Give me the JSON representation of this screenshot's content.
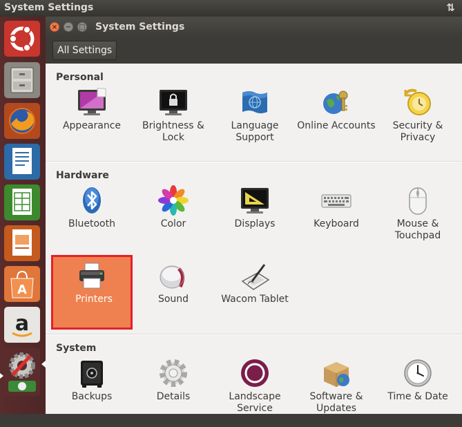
{
  "top_panel": {
    "title": "System Settings",
    "arrows_icon": "network-updown-icon"
  },
  "launcher": {
    "items": [
      {
        "name": "ubuntu-dash",
        "icon": "ubuntu-logo-icon"
      },
      {
        "name": "files",
        "icon": "file-cabinet-icon"
      },
      {
        "name": "firefox",
        "icon": "firefox-icon"
      },
      {
        "name": "writer",
        "icon": "libreoffice-writer-icon"
      },
      {
        "name": "calc",
        "icon": "libreoffice-calc-icon"
      },
      {
        "name": "impress",
        "icon": "libreoffice-impress-icon"
      },
      {
        "name": "software-center",
        "icon": "shopping-bag-icon"
      },
      {
        "name": "amazon",
        "icon": "amazon-icon"
      },
      {
        "name": "system-settings",
        "icon": "settings-gear-icon"
      }
    ]
  },
  "window": {
    "title": "System Settings",
    "close_glyph": "×",
    "min_glyph": "−",
    "max_glyph": "□",
    "toolbar": {
      "all_settings_label": "All Settings"
    }
  },
  "sections": {
    "personal": {
      "title": "Personal",
      "items": [
        {
          "label": "Appearance",
          "icon": "appearance-monitor-icon"
        },
        {
          "label": "Brightness & Lock",
          "icon": "brightness-lock-icon"
        },
        {
          "label": "Language Support",
          "icon": "language-flag-icon"
        },
        {
          "label": "Online Accounts",
          "icon": "online-accounts-globe-icon"
        },
        {
          "label": "Security & Privacy",
          "icon": "security-clock-icon"
        }
      ]
    },
    "hardware": {
      "title": "Hardware",
      "items": [
        {
          "label": "Bluetooth",
          "icon": "bluetooth-icon"
        },
        {
          "label": "Color",
          "icon": "color-flower-icon"
        },
        {
          "label": "Displays",
          "icon": "displays-monitor-icon"
        },
        {
          "label": "Keyboard",
          "icon": "keyboard-icon"
        },
        {
          "label": "Mouse & Touchpad",
          "icon": "mouse-icon"
        },
        {
          "label": "Printers",
          "icon": "printer-icon",
          "selected": true
        },
        {
          "label": "Sound",
          "icon": "speaker-icon"
        },
        {
          "label": "Wacom Tablet",
          "icon": "wacom-tablet-icon"
        }
      ]
    },
    "system": {
      "title": "System",
      "items": [
        {
          "label": "Backups",
          "icon": "backup-safe-icon"
        },
        {
          "label": "Details",
          "icon": "details-gear-icon"
        },
        {
          "label": "Landscape Service",
          "icon": "landscape-circle-icon"
        },
        {
          "label": "Software & Updates",
          "icon": "software-box-icon"
        },
        {
          "label": "Time & Date",
          "icon": "clock-icon"
        }
      ]
    }
  },
  "colors": {
    "selected_bg": "#ef8150",
    "selected_border": "#e3202a",
    "launcher_bg": "#5a2c2c"
  }
}
